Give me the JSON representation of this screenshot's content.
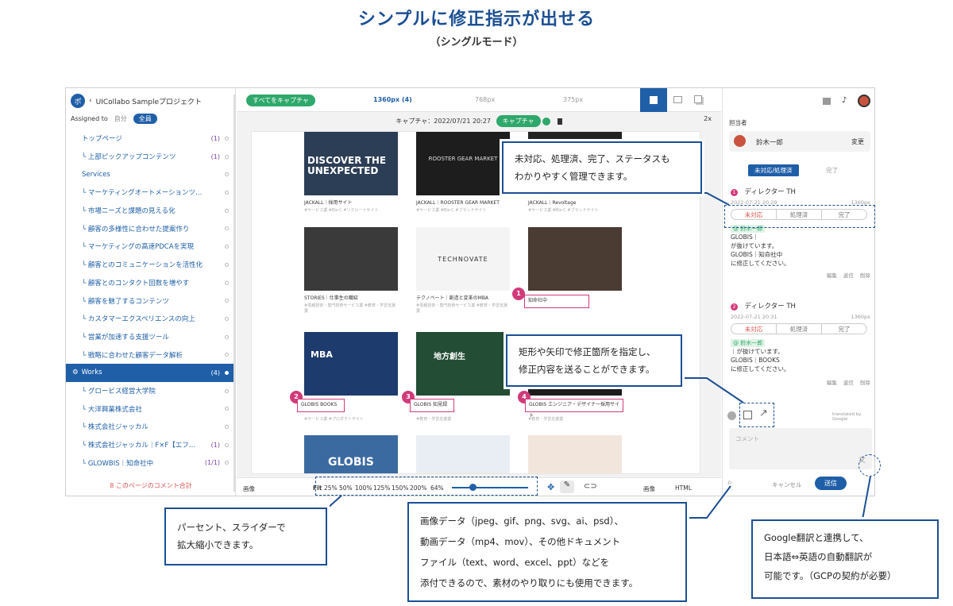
{
  "hero": {
    "title": "シンプルに修正指示が出せる",
    "subtitle": "（シングルモード）"
  },
  "sidebar": {
    "avatar": "ポ",
    "project": "UICollabo Sampleプロジェクト",
    "assigned_label": "Assigned to",
    "filter_self": "自分",
    "filter_all": "全員",
    "items": [
      {
        "label": "トップページ",
        "count": "(1)"
      },
      {
        "label": "└ 上部ピックアップコンテンツ",
        "count": "(1)"
      },
      {
        "label": "Services",
        "count": ""
      },
      {
        "label": "└ マーケティングオートメーションツ…",
        "count": ""
      },
      {
        "label": "└ 市場ニーズと課題の見える化",
        "count": ""
      },
      {
        "label": "└ 顧客の多様性に合わせた提案作り",
        "count": ""
      },
      {
        "label": "└ マーケティングの高速PDCAを実現",
        "count": ""
      },
      {
        "label": "└ 顧客とのコミュニケーションを活性化",
        "count": ""
      },
      {
        "label": "└ 顧客とのコンタクト回数を増やす",
        "count": ""
      },
      {
        "label": "└ 顧客を魅了するコンテンツ",
        "count": ""
      },
      {
        "label": "└ カスタマーエクスペリエンスの向上",
        "count": ""
      },
      {
        "label": "└ 営業が加速する支援ツール",
        "count": ""
      },
      {
        "label": "└ 戦略に合わせた顧客データ解析",
        "count": ""
      },
      {
        "label": "Works",
        "count": "(4)"
      },
      {
        "label": "└ グロービス経営大学院",
        "count": ""
      },
      {
        "label": "└ 大洋興業株式会社",
        "count": ""
      },
      {
        "label": "└ 株式会社ジャッカル",
        "count": ""
      },
      {
        "label": "└ 株式会社ジャッカル｜F×F【エフ…",
        "count": "(1)"
      },
      {
        "label": "└ GLOWBIS｜知命社中",
        "count": "(1/1)"
      }
    ],
    "footer": "8 このページのコメント合計"
  },
  "main": {
    "capture_all": "すべてをキャプチャ",
    "devices": [
      "1360px (4)",
      "768px",
      "375px"
    ],
    "capture_info": "キャプチャ：2022/07/21 20:27",
    "capture_btn": "キャプチャ",
    "zoom_2x": "2x",
    "cards": [
      {
        "title": "DISCOVER THE UNEXPECTED",
        "cap": "JACKALL｜採用サイト",
        "tags": "#サービス業 #Biz-C #リクルートサイト"
      },
      {
        "title": "ROOSTER GEAR MARKET",
        "cap": "JACKALL｜ROOSTER GEAR MARKET",
        "tags": "#サービス業 #Biz-C #ブランドサイト"
      },
      {
        "title": "",
        "cap": "JACKALL｜Revoltage",
        "tags": "#サービス業 #Biz-C #ブランドサイト"
      },
      {
        "title": "",
        "cap": "STORIES｜仕事生の職紹",
        "tags": "#情報技術・専門技術サービス業 #教育・学習支援業"
      },
      {
        "title": "TECHNOVATE",
        "cap": "テクノベート｜創造と変革のMBA",
        "tags": "#情報技術・専門技術サービス業 #教育・学習支援業"
      },
      {
        "title": "",
        "cap": "知命社中",
        "tags": ""
      },
      {
        "title": "MBA",
        "cap": "GLOBIS BOOKS",
        "tags": "#サービス業 #プロダクトサイト"
      },
      {
        "title": "地方創生",
        "cap": "GLOBIS 知見録",
        "tags": "#教育・学習支援業"
      },
      {
        "title": "",
        "cap": "GLOBIS エンジニア・デザイナー採用サイト",
        "tags": "#教育・学習支援業"
      },
      {
        "title": "GLOBIS",
        "cap": "",
        "tags": ""
      },
      {
        "title": "",
        "cap": "",
        "tags": ""
      },
      {
        "title": "",
        "cap": "",
        "tags": ""
      }
    ],
    "bottom": {
      "image_left": "画像",
      "fit": "Fit",
      "zooms": [
        "25%",
        "50%",
        "100%",
        "125%",
        "150%",
        "200%"
      ],
      "current": "64%",
      "image_right": "画像",
      "html": "HTML"
    }
  },
  "right": {
    "reporter_label": "担当者",
    "reporter": "鈴木一郎",
    "change": "変更",
    "tab_active": "未対応/処理済",
    "tab_done": "完了",
    "statuses": [
      "未対応",
      "処理済",
      "完了"
    ],
    "comment1": {
      "num": "1",
      "author": "ディレクター TH",
      "date": "2022-07-21 20:29",
      "res": "1360px",
      "mention": "@ 鈴木一郎",
      "lines": [
        "GLOBIS｜",
        "が抜けています。",
        "GLOBIS｜知命社中",
        "に修正してください。"
      ]
    },
    "comment2": {
      "num": "2",
      "author": "ディレクター TH",
      "date": "2022-07-21 20:31",
      "res": "1360px",
      "mention": "@ 鈴木一郎",
      "lines": [
        "｜が抜けています。",
        "GLOBIS｜BOOKS",
        "に修正してください。"
      ]
    },
    "actions": [
      "編集",
      "返信",
      "削除"
    ],
    "translated": "translated by Google",
    "placeholder": "コメント",
    "cancel": "キャンセル",
    "send": "送信"
  },
  "callouts": {
    "status": [
      "未対応、処理済、完了、ステータスも",
      "わかりやすく管理できます。"
    ],
    "rect": [
      "矩形や矢印で修正箇所を指定し、",
      "修正内容を送ることができます。"
    ],
    "zoom": [
      "パーセント、スライダーで",
      "拡大縮小できます。"
    ],
    "attach": [
      "画像データ（jpeg、gif、png、svg、ai、psd）、",
      "動画データ（mp4、mov）、その他ドキュメント",
      "ファイル（text、word、excel、ppt）などを",
      "添付できるので、素材のやり取りにも使用できます。"
    ],
    "translate": [
      "Google翻訳と連携して、",
      "日本語⇔英語の自動翻訳が",
      "可能です。（GCPの契約が必要）"
    ]
  },
  "markers": [
    {
      "num": "1",
      "label": "知命社中"
    },
    {
      "num": "2",
      "label": "GLOBIS BOOKS"
    },
    {
      "num": "3",
      "label": "GLOBIS 知見録"
    },
    {
      "num": "4",
      "label": "GLOBIS エンジニア・デザイナー採用サイト"
    }
  ],
  "colors": {
    "brand": "#1f5fa8",
    "accent_green": "#2ea86b",
    "marker": "#d23a7a",
    "callout": "#1b4f93"
  }
}
